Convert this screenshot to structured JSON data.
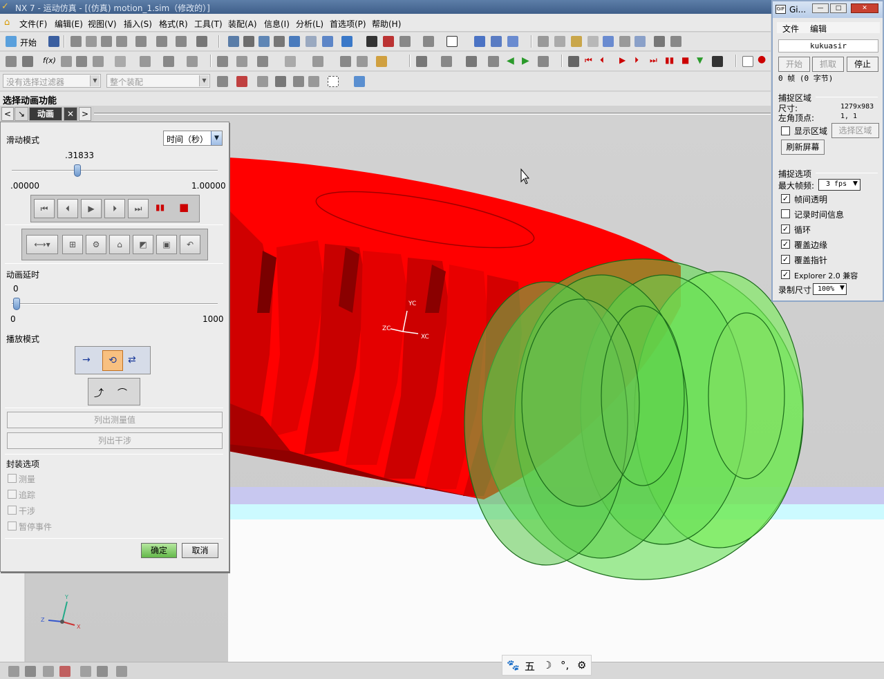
{
  "window": {
    "title": "NX 7 - 运动仿真 - [(仿真) motion_1.sim（修改的）]"
  },
  "menu": {
    "items": [
      "文件(F)",
      "编辑(E)",
      "视图(V)",
      "插入(S)",
      "格式(R)",
      "工具(T)",
      "装配(A)",
      "信息(I)",
      "分析(L)",
      "首选项(P)",
      "帮助(H)"
    ]
  },
  "toolbar": {
    "start_label": "开始",
    "filter_placeholder": "没有选择过滤器",
    "scope_placeholder": "整个装配"
  },
  "cue_line": "选择动画功能",
  "tab": {
    "title": "动画"
  },
  "dialog": {
    "slide_mode_label": "滑动模式",
    "slide_mode_value": "时间（秒）",
    "time_value": ".31833",
    "time_value_fraction": 0.31833,
    "time_min": ".00000",
    "time_max": "1.00000",
    "delay_label": "动画延时",
    "delay_value": "0",
    "delay_fraction": 0,
    "delay_min": "0",
    "delay_max": "1000",
    "playback_label": "播放模式",
    "list_measure": "列出测量值",
    "list_interference": "列出干涉",
    "envelope_label": "封装选项",
    "envelope_options": [
      "测量",
      "追踪",
      "干涉",
      "暂停事件"
    ],
    "ok": "确定",
    "cancel": "取消"
  },
  "gif": {
    "title": "Gi...",
    "menu": [
      "文件",
      "编辑"
    ],
    "user": "kukuasir",
    "btn_start": "开始",
    "btn_grab": "抓取",
    "btn_stop": "停止",
    "frames": "0 帧 (0 字节)",
    "capture_area_label": "捕捉区域",
    "size_label": "尺寸:",
    "size_value": "1279x983",
    "corner_label": "左角顶点:",
    "corner_value": "1, 1",
    "show_area": "显示区域",
    "select_area": "选择区域",
    "refresh": "刷新屏幕",
    "options_label": "捕捉选项",
    "max_fps_label": "最大帧频:",
    "max_fps_value": "3 fps",
    "opt_transparent": "帧间透明",
    "opt_timeinfo": "记录时间信息",
    "opt_loop": "循环",
    "opt_border": "覆盖边缘",
    "opt_cursor": "覆盖指针",
    "opt_explorer": "Explorer 2.0 兼容",
    "rec_size_label": "录制尺寸",
    "rec_size_value": "100%"
  },
  "axes": {
    "yc": "YC",
    "zc": "ZC",
    "xc": "XC",
    "y": "Y",
    "z": "Z",
    "x": "X"
  },
  "ime": {
    "mode": "五"
  },
  "colors": {
    "worm_gear": "#ff0000",
    "worm": "#55dd44",
    "background": "#cfcfcf"
  }
}
